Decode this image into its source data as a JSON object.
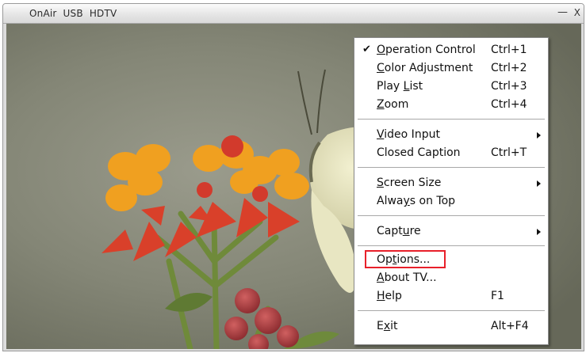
{
  "window": {
    "title": "OnAir  USB  HDTV",
    "minimize_label": "—",
    "close_label": "X"
  },
  "menu": {
    "items": [
      {
        "pre": "",
        "mnemonic": "O",
        "post": "peration Control",
        "shortcut": "Ctrl+1",
        "checked": true,
        "submenu": false
      },
      {
        "pre": "",
        "mnemonic": "C",
        "post": "olor Adjustment",
        "shortcut": "Ctrl+2",
        "checked": false,
        "submenu": false
      },
      {
        "pre": "Play ",
        "mnemonic": "L",
        "post": "ist",
        "shortcut": "Ctrl+3",
        "checked": false,
        "submenu": false
      },
      {
        "pre": "",
        "mnemonic": "Z",
        "post": "oom",
        "shortcut": "Ctrl+4",
        "checked": false,
        "submenu": false
      },
      {
        "pre": "",
        "mnemonic": "V",
        "post": "ideo Input",
        "shortcut": "",
        "checked": false,
        "submenu": true
      },
      {
        "pre": "Closed Caption",
        "mnemonic": "",
        "post": "",
        "shortcut": "Ctrl+T",
        "checked": false,
        "submenu": false
      },
      {
        "pre": "",
        "mnemonic": "S",
        "post": "creen Size",
        "shortcut": "",
        "checked": false,
        "submenu": true
      },
      {
        "pre": "Alwa",
        "mnemonic": "y",
        "post": "s on Top",
        "shortcut": "",
        "checked": false,
        "submenu": false
      },
      {
        "pre": "Capt",
        "mnemonic": "u",
        "post": "re",
        "shortcut": "",
        "checked": false,
        "submenu": true
      },
      {
        "pre": "Op",
        "mnemonic": "t",
        "post": "ions...",
        "shortcut": "",
        "checked": false,
        "submenu": false,
        "highlighted": true
      },
      {
        "pre": "",
        "mnemonic": "A",
        "post": "bout TV...",
        "shortcut": "",
        "checked": false,
        "submenu": false
      },
      {
        "pre": "",
        "mnemonic": "H",
        "post": "elp",
        "shortcut": "F1",
        "checked": false,
        "submenu": false
      },
      {
        "pre": "E",
        "mnemonic": "x",
        "post": "it",
        "shortcut": "Alt+F4",
        "checked": false,
        "submenu": false
      }
    ],
    "check_glyph": "✔"
  },
  "colors": {
    "highlight_border": "#e8202a",
    "video_background": "#7c7e6e"
  },
  "video": {
    "scene": "orange milkweed flowers with white butterfly"
  }
}
